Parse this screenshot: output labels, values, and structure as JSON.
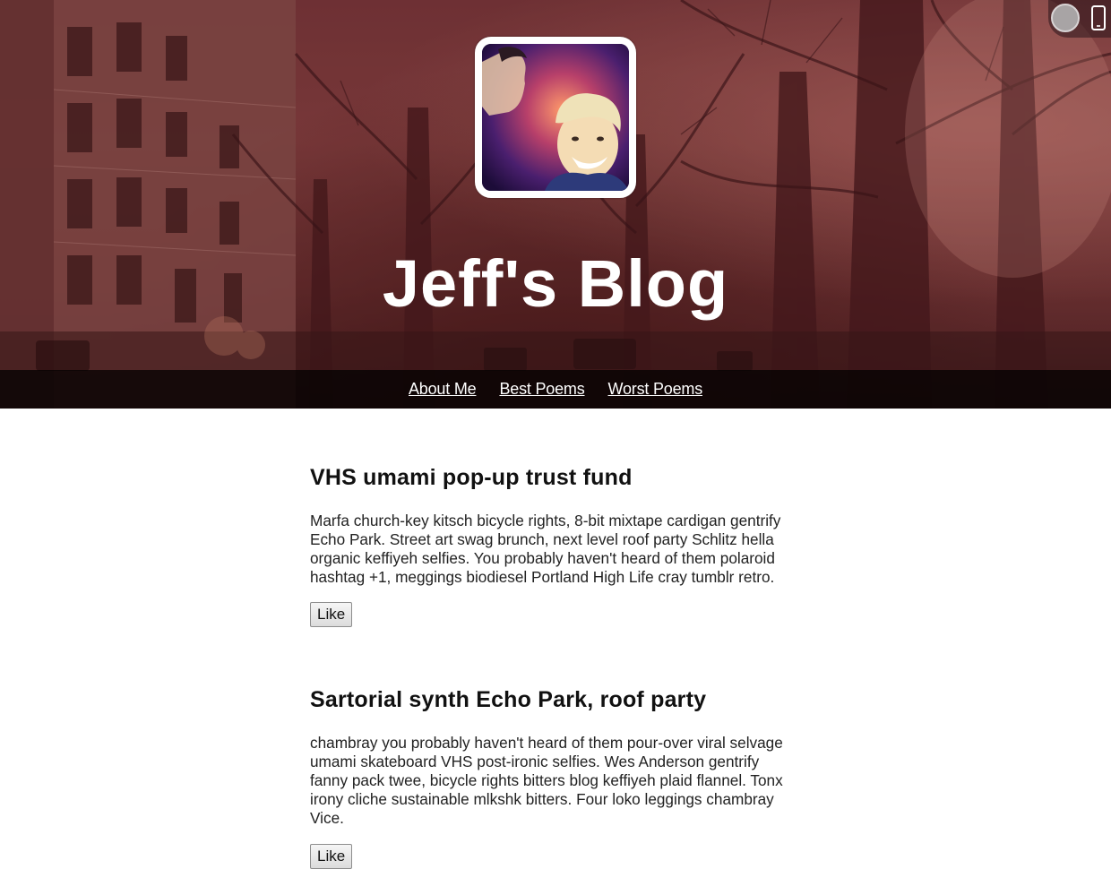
{
  "site": {
    "title": "Jeff's Blog"
  },
  "nav": {
    "items": [
      {
        "label": "About Me"
      },
      {
        "label": "Best Poems"
      },
      {
        "label": "Worst Poems"
      }
    ]
  },
  "tools": {
    "circle_icon": "circle-toggle-icon",
    "phone_icon": "mobile-phone-icon"
  },
  "posts": [
    {
      "title": "VHS umami pop-up trust fund",
      "body": "Marfa church-key kitsch bicycle rights, 8-bit mixtape cardigan gentrify Echo Park. Street art swag brunch, next level roof party Schlitz hella organic keffiyeh selfies. You probably haven't heard of them polaroid hashtag +1, meggings biodiesel Portland High Life cray tumblr retro.",
      "like_label": "Like"
    },
    {
      "title": "Sartorial synth Echo Park, roof party",
      "body": "chambray you probably haven't heard of them pour-over viral selvage umami skateboard VHS post-ironic selfies. Wes Anderson gentrify fanny pack twee, bicycle rights bitters blog keffiyeh plaid flannel. Tonx irony cliche sustainable mlkshk bitters. Four loko leggings chambray Vice.",
      "like_label": "Like"
    }
  ],
  "colors": {
    "hero_tint": "#6e3336",
    "nav_bar": "#000000",
    "text": "#111111"
  }
}
